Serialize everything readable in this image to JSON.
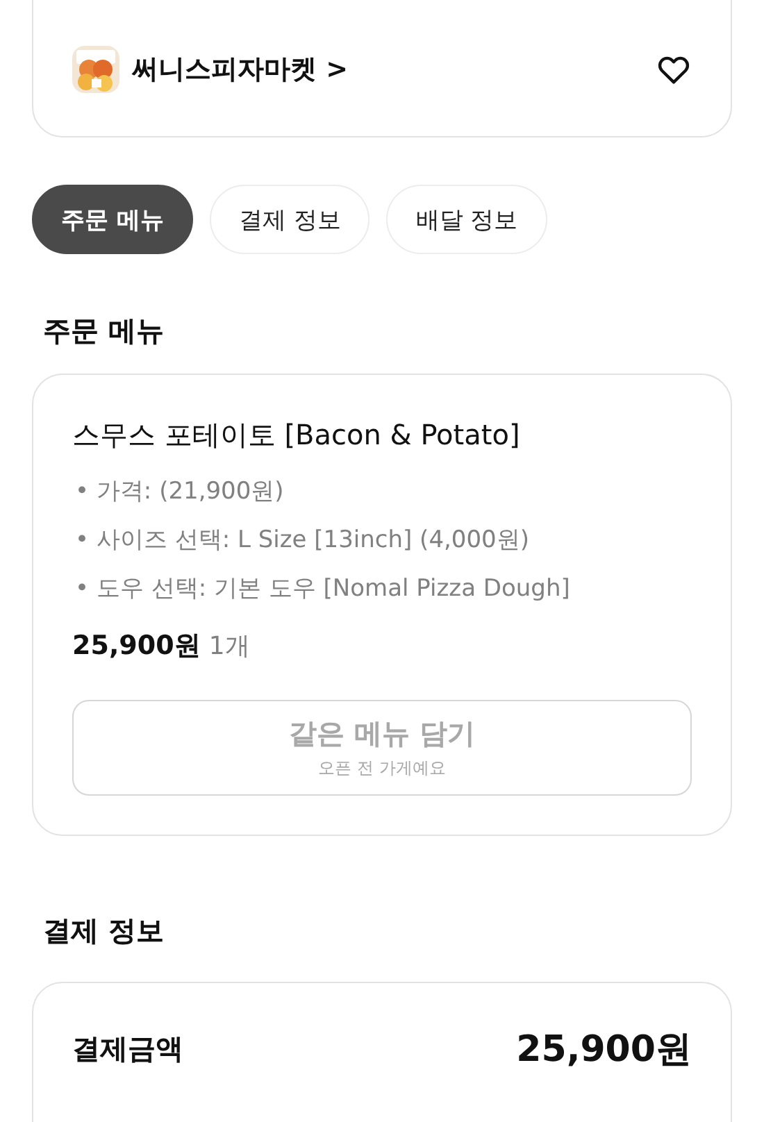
{
  "store": {
    "name": "써니스피자마켓",
    "arrow": ">",
    "favorite": false
  },
  "tabs": [
    {
      "label": "주문 메뉴",
      "selected": true
    },
    {
      "label": "결제 정보",
      "selected": false
    },
    {
      "label": "배달 정보",
      "selected": false
    }
  ],
  "order_section": {
    "title": "주문 메뉴",
    "item": {
      "name": "스무스 포테이토 [Bacon & Potato]",
      "options": [
        "• 가격: (21,900원)",
        "• 사이즈 선택: L Size [13inch] (4,000원)",
        "• 도우 선택: 기본 도우 [Nomal Pizza Dough]"
      ],
      "price": "25,900원",
      "quantity": "1개"
    },
    "add_button": {
      "label": "같은 메뉴 담기",
      "note": "오픈 전 가게예요",
      "disabled": true
    }
  },
  "payment_section": {
    "title": "결제 정보",
    "label": "결제금액",
    "amount": "25,900원"
  }
}
